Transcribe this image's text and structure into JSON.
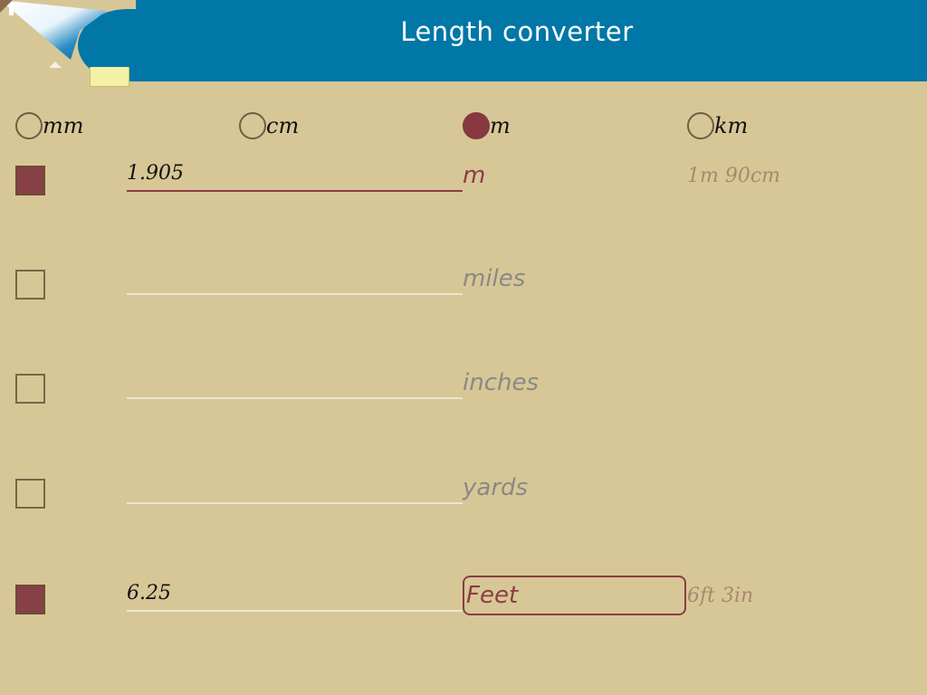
{
  "app": {
    "title": "Length converter"
  },
  "colors": {
    "header": "#0077a6",
    "background": "#d7c797",
    "accent": "#87393f"
  },
  "units_selector": {
    "options": [
      {
        "label": "mm",
        "selected": false
      },
      {
        "label": "cm",
        "selected": false
      },
      {
        "label": "m",
        "selected": true
      },
      {
        "label": "km",
        "selected": false
      }
    ]
  },
  "rows": [
    {
      "checked": true,
      "value": "1.905",
      "unit": "m",
      "hint": "1m 90cm"
    },
    {
      "checked": false,
      "value": "",
      "unit": "miles",
      "hint": ""
    },
    {
      "checked": false,
      "value": "",
      "unit": "inches",
      "hint": ""
    },
    {
      "checked": false,
      "value": "",
      "unit": "yards",
      "hint": ""
    },
    {
      "checked": true,
      "value": "6.25",
      "unit": "Feet",
      "hint": "6ft 3in"
    }
  ]
}
